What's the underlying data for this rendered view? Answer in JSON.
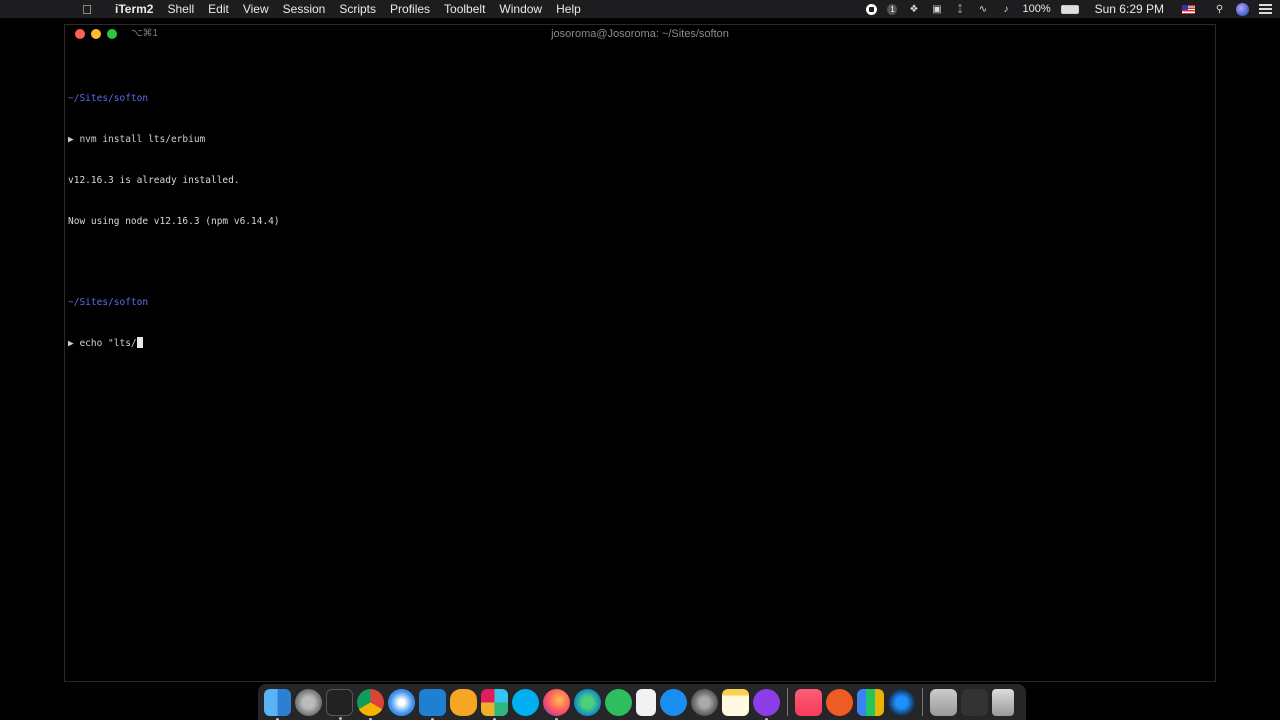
{
  "menubar": {
    "apple_icon": "apple-icon",
    "items": [
      "iTerm2",
      "Shell",
      "Edit",
      "View",
      "Session",
      "Scripts",
      "Profiles",
      "Toolbelt",
      "Window",
      "Help"
    ],
    "status": {
      "notification_badge": "1",
      "battery_percent": "100%",
      "clock": "Sun 6:29 PM"
    }
  },
  "window": {
    "shortcut": "⌥⌘1",
    "title": "josoroma@Josoroma: ~/Sites/softon"
  },
  "terminal": {
    "line1_path": "~/Sites/softon",
    "line2_prompt": "▶ nvm install lts/erbium",
    "line3": "v12.16.3 is already installed.",
    "line4": "Now using node v12.16.3 (npm v6.14.4)",
    "line6_path": "~/Sites/softon",
    "line7_prompt": "▶ echo \"lts/"
  },
  "dock": {
    "apps": [
      "finder-icon",
      "launchpad-icon",
      "iterm-icon",
      "chrome-icon",
      "safari-icon",
      "vscode-icon",
      "transmit-icon",
      "slack-icon",
      "skype-icon",
      "firefox-icon",
      "edge-canary-icon",
      "evernote-icon",
      "notes-doc-icon",
      "app-store-icon",
      "system-preferences-icon",
      "notes-icon",
      "podcasts-icon",
      "music-icon",
      "postman-icon",
      "charts-icon",
      "network-icon",
      "downloads-icon",
      "preview-icon",
      "trash-icon"
    ]
  }
}
